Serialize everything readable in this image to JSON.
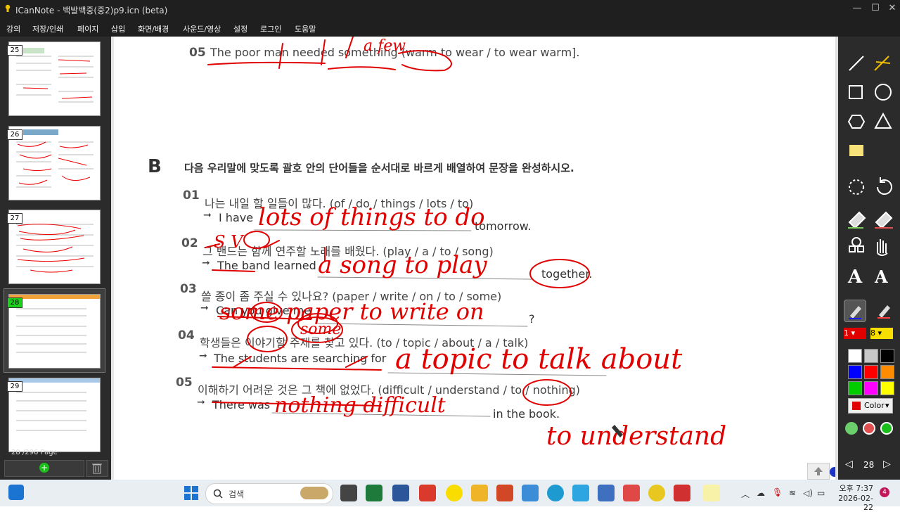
{
  "window": {
    "title": "ICanNote - 백발백중(중2)p9.icn (beta)"
  },
  "menu": [
    "강의",
    "저장/인쇄",
    "페이지",
    "삽입",
    "화면/배경",
    "사운드/영상",
    "설정",
    "로그인",
    "도움말"
  ],
  "thumbnails": [
    {
      "num": "25",
      "selected": false
    },
    {
      "num": "26",
      "selected": false
    },
    {
      "num": "27",
      "selected": false
    },
    {
      "num": "28",
      "selected": true
    },
    {
      "num": "29",
      "selected": false
    }
  ],
  "page_info": {
    "current": "28",
    "total": "/296 Page"
  },
  "document": {
    "prev_q_num": "05",
    "prev_q_text": "The poor man needed something (warm to wear / to wear warm].",
    "section": "B",
    "instruction": "다음 우리말에 맞도록 괄호 안의 단어들을 순서대로 바르게 배열하여 문장을 완성하시오.",
    "questions": [
      {
        "num": "01",
        "korean": "나는 내일 할 일들이 많다. (of / do / things / lots / to)",
        "prefix": "I have",
        "suffix": "tomorrow."
      },
      {
        "num": "02",
        "korean": "그 밴드는 함께 연주할 노래를 배웠다. (play / a / to / song)",
        "prefix": "The band learned",
        "suffix": "together."
      },
      {
        "num": "03",
        "korean": "쓸 종이 좀 주실 수 있나요? (paper / write / on / to / some)",
        "prefix": "Can you give me",
        "suffix": "?"
      },
      {
        "num": "04",
        "korean": "학생들은 이야기할 주제를 찾고 있다. (to / topic / about / a / talk)",
        "prefix": "The students are searching for",
        "suffix": ""
      },
      {
        "num": "05",
        "korean": "이해하기 어려운 것은 그 책에 없었다. (difficult / understand / to / nothing)",
        "prefix": "There was",
        "suffix": "in the book."
      }
    ],
    "handwriting": {
      "a01": "lots of things to do",
      "a02": "a song to play",
      "a03": "some paper to write on",
      "a04": "a topic to talk about",
      "a05a": "nothing difficult",
      "a05b": "to understand",
      "note_a_few": "a few",
      "note_some": "some",
      "note_s_v": "S V"
    }
  },
  "right_panel": {
    "pen_color_index": "1",
    "pen_size": "8",
    "color_button": "Color",
    "page_nav": "28",
    "swatches": [
      "#ffffff",
      "#c8c8c8",
      "#000000",
      "#0000ff",
      "#ff0000",
      "#ff8c00",
      "#00cc00",
      "#ff00ff",
      "#ffff00"
    ]
  },
  "taskbar": {
    "search_placeholder": "검색",
    "time": "오후 7:37",
    "date": "2026-02-22",
    "notif_count": "4"
  },
  "colors": {
    "ink": "#e00000",
    "accent_green": "#1bd11b",
    "dark_panel": "#2b2b2b"
  }
}
